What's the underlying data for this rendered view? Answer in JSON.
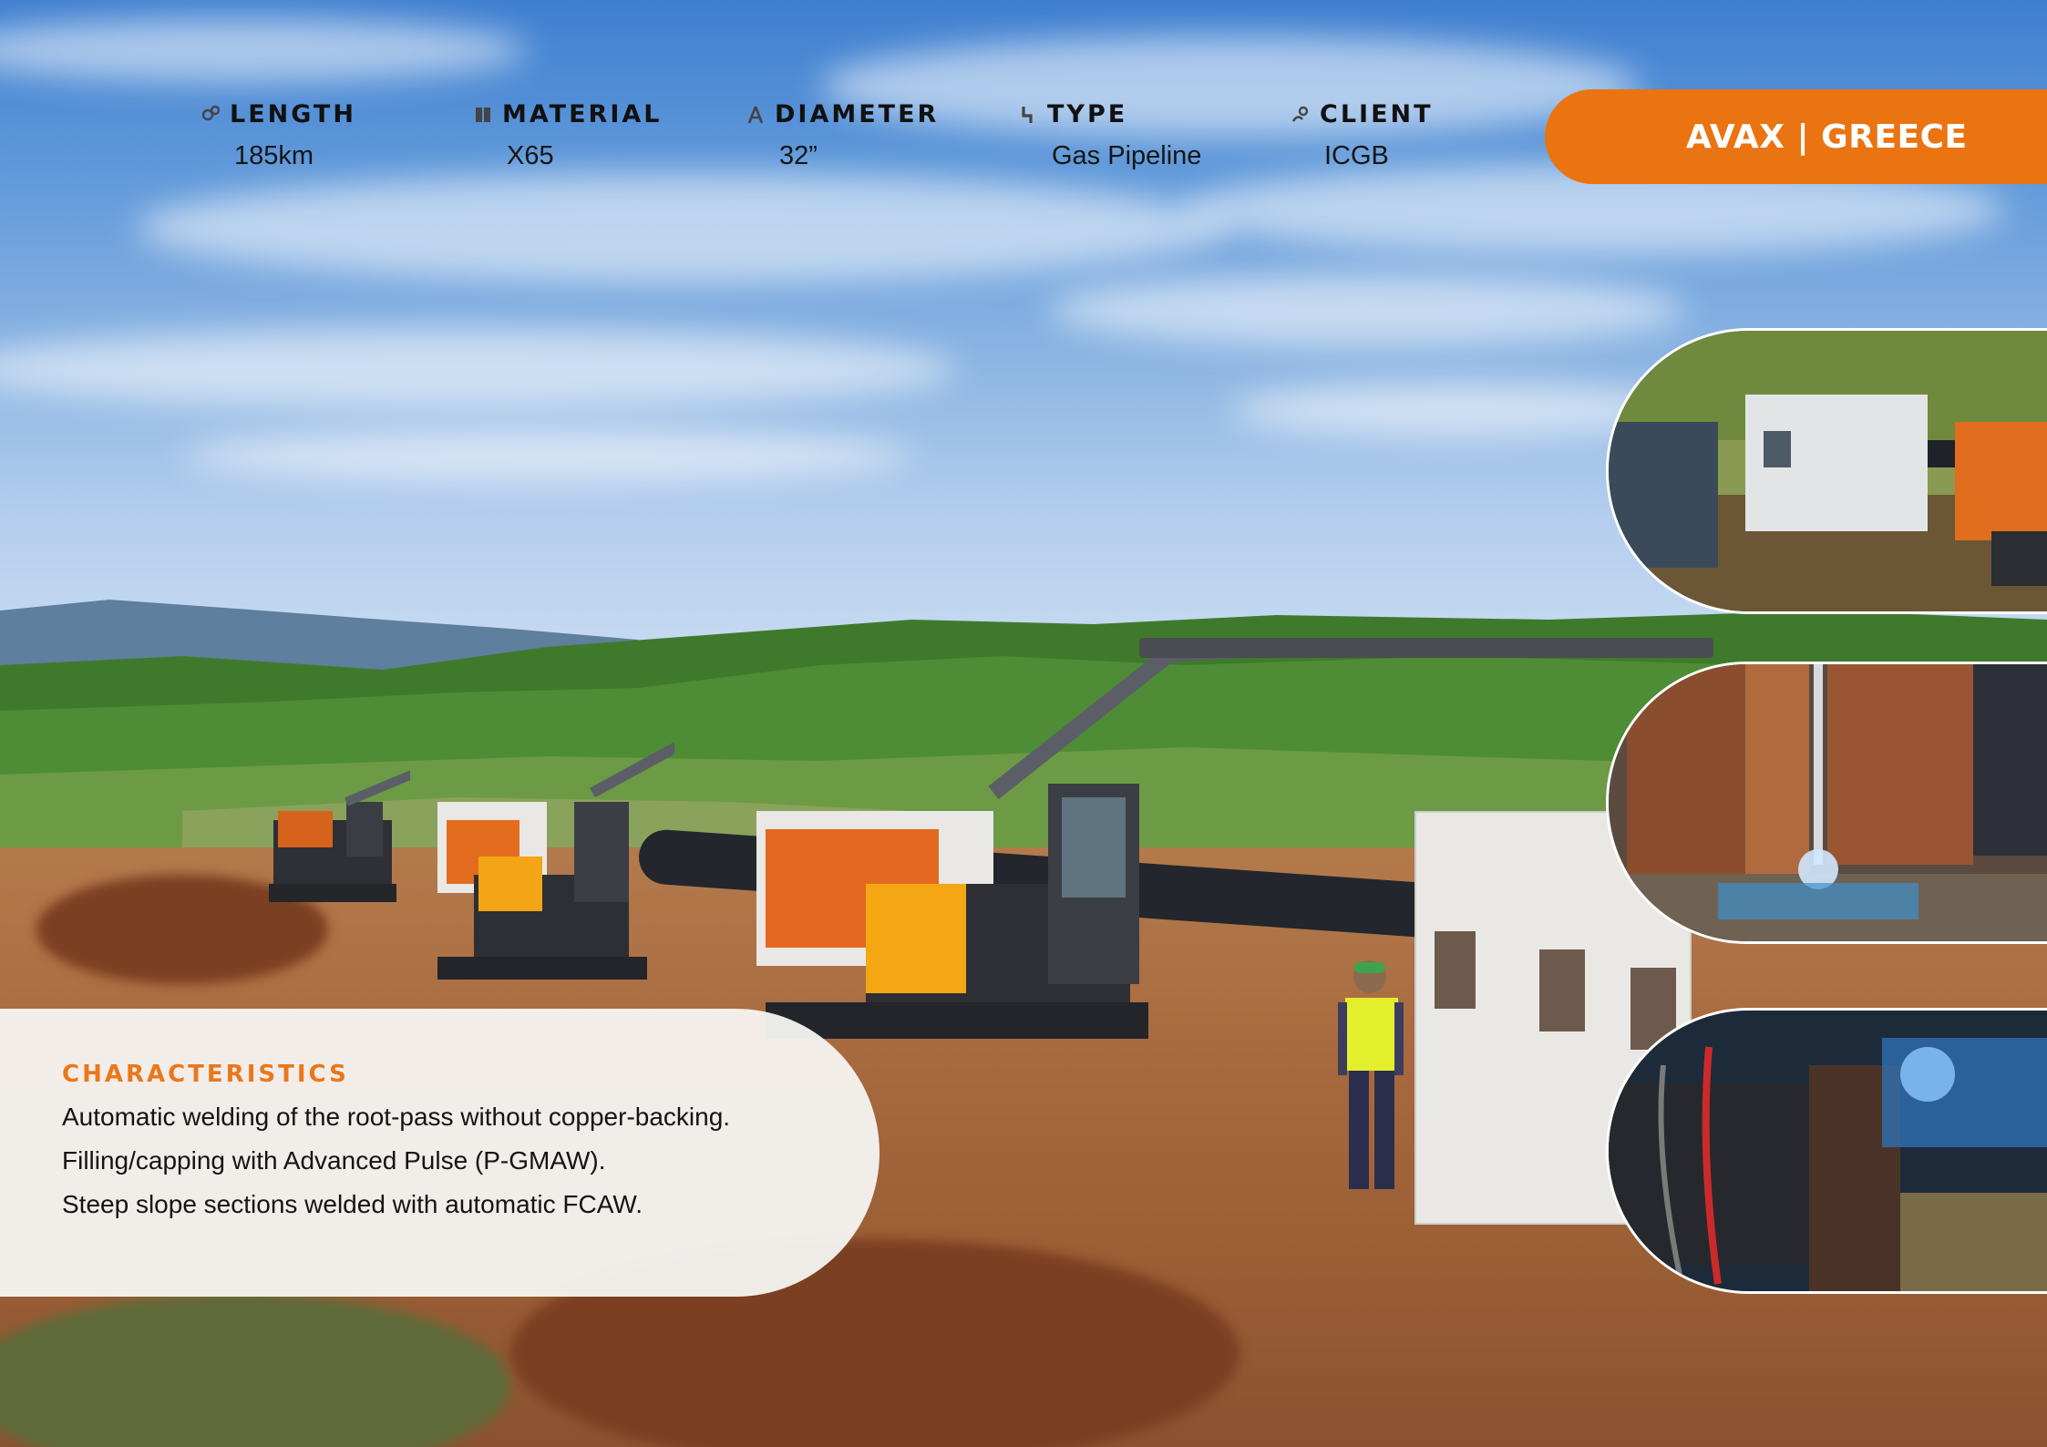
{
  "specs": [
    {
      "label": "LENGTH",
      "value": "185km",
      "icon": "map-pin-icon"
    },
    {
      "label": "MATERIAL",
      "value": "X65",
      "icon": "book-icon"
    },
    {
      "label": "DIAMETER",
      "value": "32”",
      "icon": "compass-icon"
    },
    {
      "label": "TYPE",
      "value": "Gas Pipeline",
      "icon": "pipe-icon"
    },
    {
      "label": "CLIENT",
      "value": "ICGB",
      "icon": "user-icon"
    }
  ],
  "badge": {
    "label": "AVAX | GREECE"
  },
  "characteristics": {
    "title": "CHARACTERISTICS",
    "lines": [
      "Automatic welding of the root-pass without copper-backing.",
      "Filling/capping with Advanced Pulse (P-GMAW).",
      "Steep slope sections welded with automatic FCAW."
    ]
  },
  "colors": {
    "accent": "#ea7411",
    "text": "#141414"
  }
}
